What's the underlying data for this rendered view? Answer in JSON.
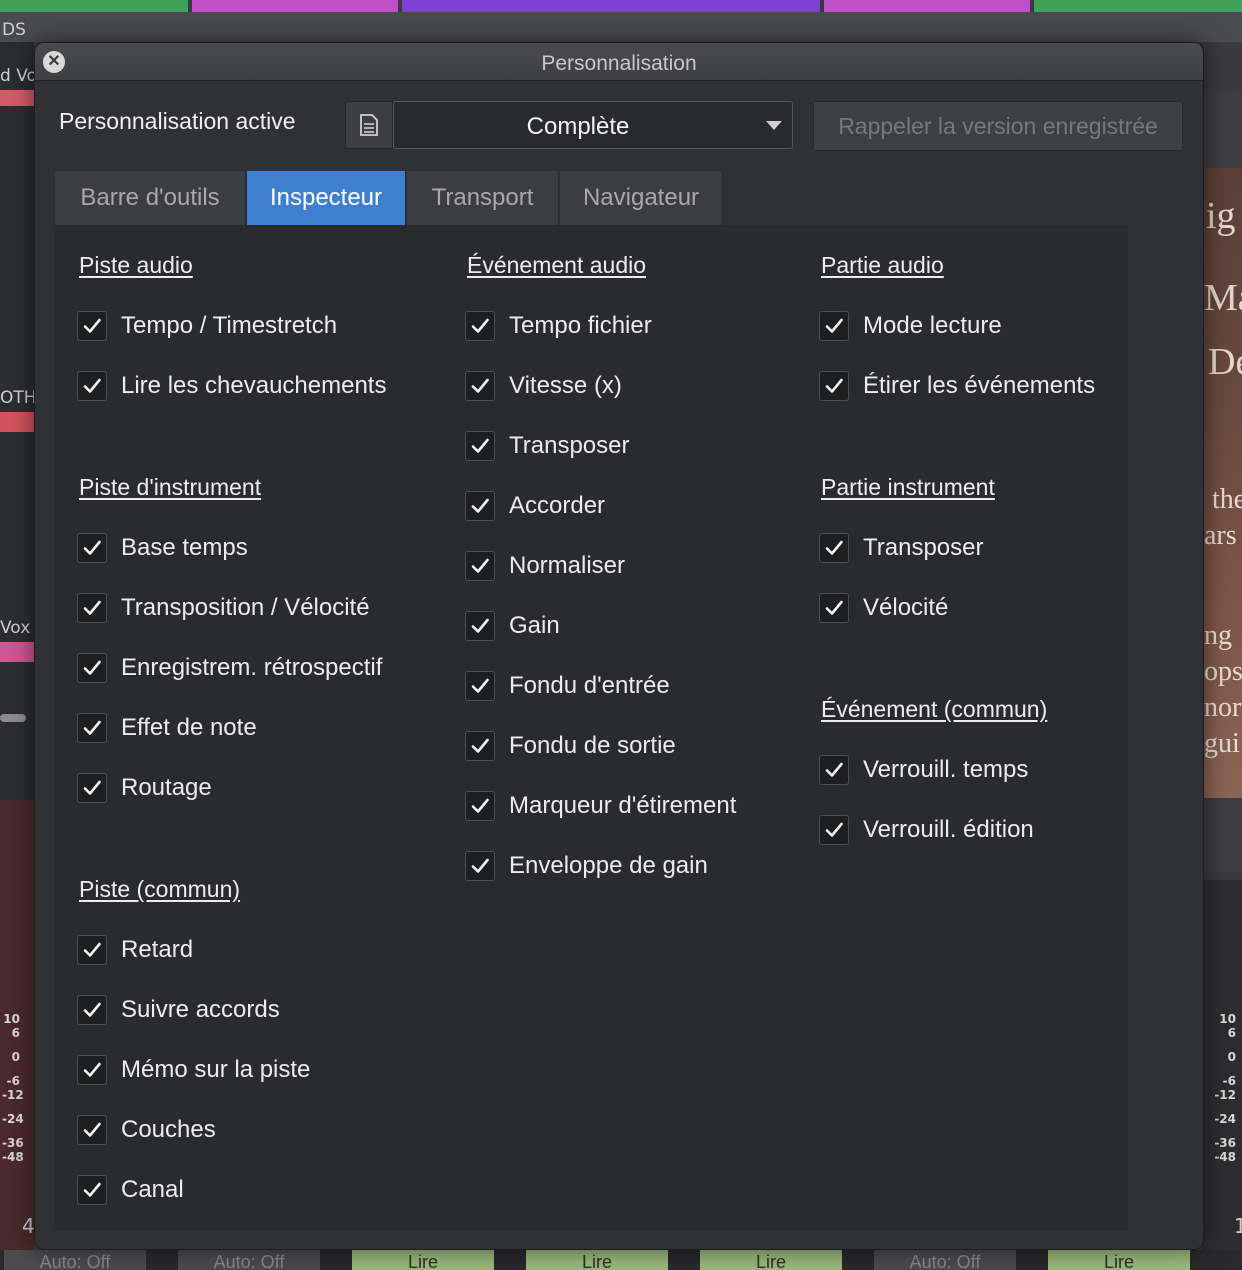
{
  "background": {
    "top_strip_colors": [
      "#3fa15a",
      "#c04ec8",
      "#7e3fd4",
      "#c04ec8",
      "#3fa15a"
    ],
    "left_track_labels": [
      "DS",
      "d Vo",
      "OTH",
      "Vox"
    ],
    "right_photo_text": [
      "ig",
      "Ma",
      "De",
      "the",
      "ars",
      "ng",
      "ops",
      "nor",
      "gui"
    ],
    "meter_scale": [
      "10",
      "6",
      "0",
      "-6",
      "-12",
      "-24",
      "-36",
      "-48"
    ],
    "left_fader_value": "4",
    "right_fader_value": "1",
    "bottom_cells": [
      "Auto: Off",
      "Auto: Off",
      "Lire",
      "Lire",
      "Lire",
      "Auto: Off",
      "Lire"
    ]
  },
  "dialog": {
    "title": "Personnalisation",
    "close_symbol": "✕",
    "active_label": "Personnalisation active",
    "preset_value": "Complète",
    "recall_button": "Rappeler la version enregistrée",
    "tabs": [
      {
        "label": "Barre d'outils",
        "active": false
      },
      {
        "label": "Inspecteur",
        "active": true
      },
      {
        "label": "Transport",
        "active": false
      },
      {
        "label": "Navigateur",
        "active": false
      }
    ],
    "columns": {
      "col1": {
        "piste_audio": {
          "title": "Piste audio",
          "items": [
            {
              "label": "Tempo / Timestretch",
              "checked": true
            },
            {
              "label": "Lire les chevauchements",
              "checked": true
            }
          ]
        },
        "piste_instrument": {
          "title": "Piste d'instrument",
          "items": [
            {
              "label": "Base temps",
              "checked": true
            },
            {
              "label": "Transposition / Vélocité",
              "checked": true
            },
            {
              "label": "Enregistrem. rétrospectif",
              "checked": true
            },
            {
              "label": "Effet de note",
              "checked": true
            },
            {
              "label": "Routage",
              "checked": true
            }
          ]
        },
        "piste_commun": {
          "title": "Piste (commun)",
          "items": [
            {
              "label": "Retard",
              "checked": true
            },
            {
              "label": "Suivre accords",
              "checked": true
            },
            {
              "label": "Mémo sur la piste",
              "checked": true
            },
            {
              "label": "Couches",
              "checked": true
            },
            {
              "label": "Canal",
              "checked": true
            }
          ]
        }
      },
      "col2": {
        "evenement_audio": {
          "title": "Événement audio",
          "items": [
            {
              "label": "Tempo fichier",
              "checked": true
            },
            {
              "label": "Vitesse (x)",
              "checked": true
            },
            {
              "label": "Transposer",
              "checked": true
            },
            {
              "label": "Accorder",
              "checked": true
            },
            {
              "label": "Normaliser",
              "checked": true
            },
            {
              "label": "Gain",
              "checked": true
            },
            {
              "label": "Fondu d'entrée",
              "checked": true
            },
            {
              "label": "Fondu de sortie",
              "checked": true
            },
            {
              "label": "Marqueur d'étirement",
              "checked": true
            },
            {
              "label": "Enveloppe de gain",
              "checked": true
            }
          ]
        }
      },
      "col3": {
        "partie_audio": {
          "title": "Partie audio",
          "items": [
            {
              "label": "Mode lecture",
              "checked": true
            },
            {
              "label": "Étirer les événements",
              "checked": true
            }
          ]
        },
        "partie_instrument": {
          "title": "Partie instrument",
          "items": [
            {
              "label": "Transposer",
              "checked": true
            },
            {
              "label": "Vélocité",
              "checked": true
            }
          ]
        },
        "evenement_commun": {
          "title": "Événement (commun)",
          "items": [
            {
              "label": "Verrouill. temps",
              "checked": true
            },
            {
              "label": "Verrouill. édition",
              "checked": true
            }
          ]
        }
      }
    }
  }
}
